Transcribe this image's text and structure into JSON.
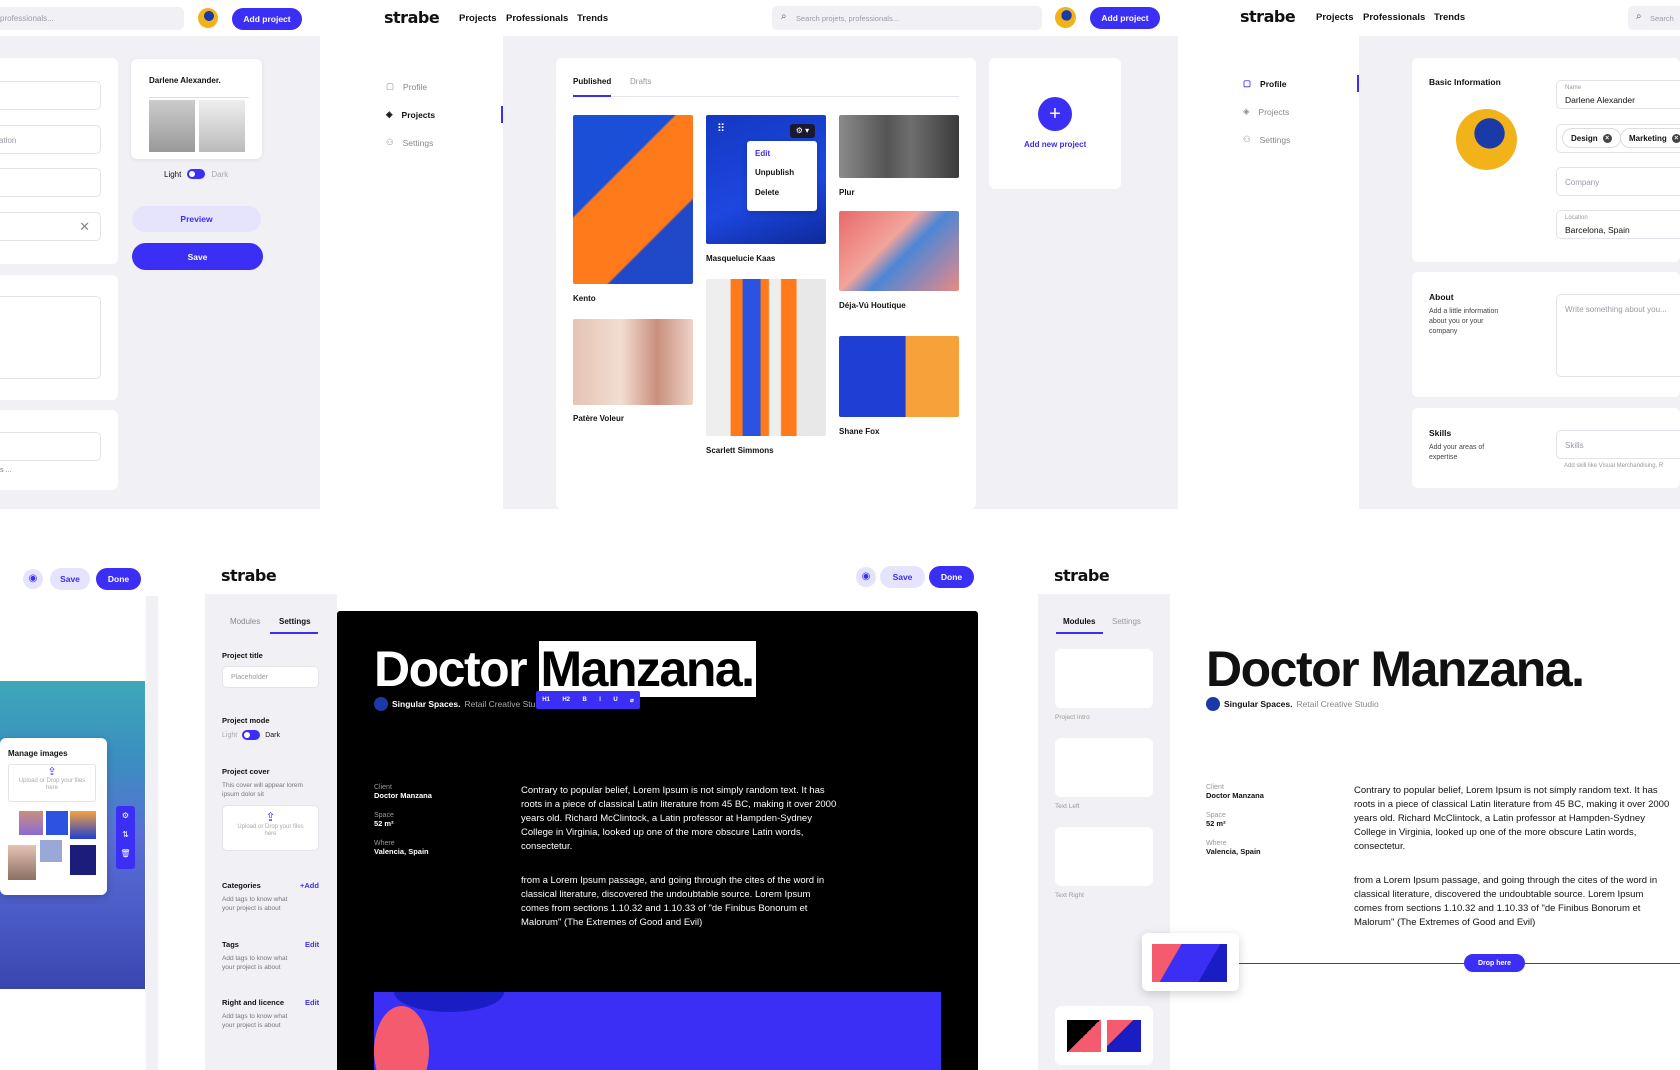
{
  "brand": {
    "logo": "strabe",
    "accent": "#3b2ef5"
  },
  "nav": {
    "projects": "Projects",
    "professionals": "Professionals",
    "trends": "Trends"
  },
  "search": {
    "placeholder": "Search projets, professionals...",
    "placeholder_short": "Search",
    "placeholder_cut": "professionals..."
  },
  "header": {
    "add_project": "Add project"
  },
  "preview_panel": {
    "name": "Darlene Alexander.",
    "light": "Light",
    "dark": "Dark",
    "preview": "Preview",
    "save": "Save",
    "input_hint": "ation",
    "tiny_hint": "s ..."
  },
  "sidebar": {
    "profile": "Profile",
    "projects": "Projects",
    "settings": "Settings"
  },
  "projects_page": {
    "tabs": [
      "Published",
      "Drafts"
    ],
    "projects": [
      {
        "name": "Kento"
      },
      {
        "name": "Masquelucie Kaas"
      },
      {
        "name": "Plur"
      },
      {
        "name": "Déja-Vú Houtique"
      },
      {
        "name": "Patère Voleur"
      },
      {
        "name": "Scarlett Simmons"
      },
      {
        "name": "Shane Fox"
      }
    ],
    "menu": [
      "Edit",
      "Unpublish",
      "Delete"
    ],
    "add_new": "Add new project"
  },
  "profile_page": {
    "basic_title": "Basic Information",
    "name_label": "Name",
    "name_value": "Darlene Alexander",
    "tags": [
      "Design",
      "Marketing"
    ],
    "company_placeholder": "Company",
    "location_label": "Location",
    "location_value": "Barcelona, Spain",
    "about_title": "About",
    "about_desc": "Add a little information about you or your company",
    "about_placeholder": "Write something about you...",
    "skills_title": "Skills",
    "skills_desc": "Add your areas of expertise",
    "skills_placeholder": "Skills",
    "skills_hint": "Add skill like Visual Merchandising, R"
  },
  "manage": {
    "title": "Manage images",
    "upload": "Upload or Drop your files here",
    "save": "Save",
    "done": "Done"
  },
  "editor": {
    "tabs": [
      "Modules",
      "Settings"
    ],
    "project_title_label": "Project title",
    "project_title_placeholder": "Placeholder",
    "project_mode_label": "Project mode",
    "light": "Light",
    "dark": "Dark",
    "project_cover_label": "Project cover",
    "project_cover_desc": "This cover will appear lorem ipsum dolor sit",
    "cover_upload": "Upload or Drop your files here",
    "categories": "Categories",
    "categories_action": "+Add",
    "tags": "Tags",
    "tags_action": "Edit",
    "rights": "Right and licence",
    "rights_action": "Edit",
    "tags_desc": "Add tags to know what your project is about",
    "toolbar": [
      "H1",
      "H2",
      "B",
      "I",
      "U",
      "⌀"
    ]
  },
  "article": {
    "title_a": "Doctor",
    "title_b": "Manzana.",
    "title_full": "Doctor Manzana.",
    "studio": "Singular Spaces.",
    "studio_sub": "Retail Creative Studio",
    "studio_sub_cut": "Retail Creative Stu",
    "client_label": "Client",
    "client": "Doctor Manzana",
    "space_label": "Space",
    "space": "52 m²",
    "where_label": "Where",
    "where": "Valencia, Spain",
    "p1": "Contrary to popular belief, Lorem Ipsum is not simply random text. It has roots in a piece of classical Latin literature from 45 BC, making it over 2000 years old. Richard McClintock, a Latin professor at Hampden-Sydney College in Virginia, looked up one of the more obscure Latin words, consectetur.",
    "p2": "from a Lorem Ipsum passage, and going through the cites of the word in classical literature, discovered the undoubtable source. Lorem Ipsum comes from sections 1.10.32 and 1.10.33 of \"de Finibus Bonorum et Malorum\" (The Extremes of Good and Evil)"
  },
  "modules": {
    "intro": "Project intro",
    "left": "Text Left",
    "right": "Text Right",
    "drop": "Drop here"
  }
}
